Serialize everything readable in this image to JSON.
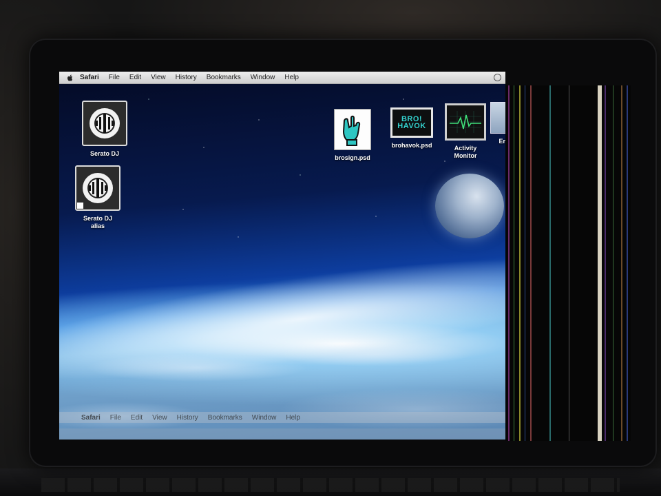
{
  "menubar": {
    "app_name": "Safari",
    "items": [
      "File",
      "Edit",
      "View",
      "History",
      "Bookmarks",
      "Window",
      "Help"
    ]
  },
  "desktop_icons": [
    {
      "label": "Serato DJ",
      "icon": "serato-dj-icon"
    },
    {
      "label": "Serato DJ",
      "label2": "alias",
      "icon": "serato-dj-alias-icon"
    },
    {
      "label": "brosign.psd",
      "icon": "psd-file-icon"
    },
    {
      "label": "brohavok.psd",
      "icon": "psd-file-icon",
      "art_text_1": "BRO!",
      "art_text_2": "HAVOK"
    },
    {
      "label": "Activity",
      "label2": "Monitor",
      "icon": "activity-monitor-icon"
    },
    {
      "label": "Er",
      "icon": "partial-icon"
    }
  ],
  "ghost_menubar": {
    "app_name": "Safari",
    "items": [
      "File",
      "Edit",
      "View",
      "History",
      "Bookmarks",
      "Window",
      "Help"
    ]
  },
  "colors": {
    "accent_teal": "#34d3cf",
    "menubar_bg": "#e4e4e4"
  }
}
